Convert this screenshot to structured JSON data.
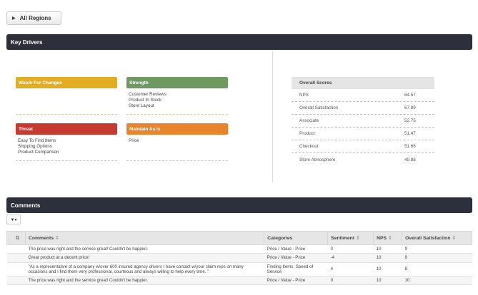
{
  "region_button": {
    "label": "All Regions",
    "icon": "triangle-right-icon"
  },
  "key_drivers": {
    "title": "Key Drivers",
    "quadrants": [
      {
        "id": "watch",
        "label": "Watch For Changes",
        "color": "#e2ad22",
        "items": []
      },
      {
        "id": "strength",
        "label": "Strength",
        "color": "#6e9a62",
        "items": [
          "Customer Reviews",
          "Product In Stock",
          "Store Layout"
        ]
      },
      {
        "id": "threat",
        "label": "Threat",
        "color": "#c73a30",
        "items": [
          "Easy To Find Items",
          "Shipping Options",
          "Product Comparison"
        ]
      },
      {
        "id": "maintain",
        "label": "Maintain As Is",
        "color": "#e8842a",
        "items": [
          "Price"
        ]
      }
    ],
    "overall_scores": {
      "header": "Overall Scores",
      "rows": [
        {
          "label": "NPS",
          "value": "84.57"
        },
        {
          "label": "Overall Satisfaction",
          "value": "67.89"
        },
        {
          "label": "Associate",
          "value": "52.75"
        },
        {
          "label": "Product",
          "value": "51.47"
        },
        {
          "label": "Checkout",
          "value": "51.66"
        },
        {
          "label": "Store Atmosphere",
          "value": "49.88"
        }
      ]
    }
  },
  "comments": {
    "title": "Comments",
    "filter_icon": "filter-icon",
    "columns": [
      "Comments",
      "Categories",
      "Sentiment",
      "NPS",
      "Overall Satisfaction"
    ],
    "rows": [
      {
        "comment": "The price was right and the service great! Couldn't be happier.",
        "category": "Price / Value - Price",
        "sentiment": "0",
        "nps": "10",
        "sat": "9"
      },
      {
        "comment": "Great product at a decent price!",
        "category": "Price / Value - Price",
        "sentiment": "-4",
        "nps": "10",
        "sat": "9"
      },
      {
        "comment": "\"As a representative of a company w/over 600 insured agency drivers I have contact w/your claim reps on many occasions and I find them very professional, courteous and always willing to help every time. \"",
        "category": "Finding Items, Speed of Service",
        "sentiment": "4",
        "nps": "10",
        "sat": "8"
      },
      {
        "comment": "The price was right and the service great! Couldn't be happier.",
        "category": "Price / Value - Price",
        "sentiment": "0",
        "nps": "10",
        "sat": "10"
      }
    ]
  }
}
